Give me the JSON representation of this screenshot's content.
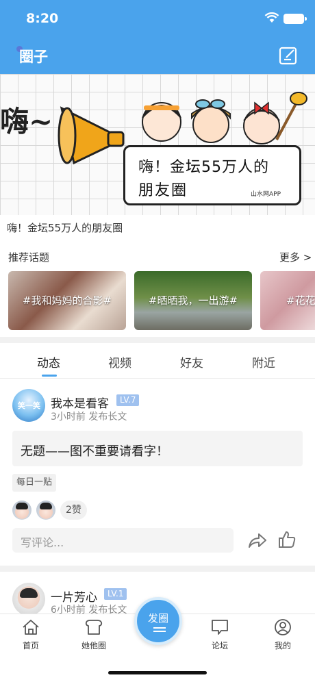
{
  "status_bar": {
    "time": "8:20"
  },
  "header": {
    "title": "圈子",
    "edit_icon": "edit-icon"
  },
  "banner": {
    "exclaim": "嗨~",
    "bubble_line1": "嗨！金坛55万人的",
    "bubble_line2": "朋友圈",
    "brand": "山水网APP",
    "caption": "嗨！金坛55万人的朋友圈"
  },
  "topics": {
    "title": "推荐话题",
    "more": "更多 >",
    "items": [
      "#我和妈妈的合影#",
      "#晒晒我，一出游#",
      "#花花"
    ]
  },
  "tabs": [
    "动态",
    "视频",
    "好友",
    "附近"
  ],
  "active_tab": "动态",
  "posts": [
    {
      "user": "我本是看客",
      "level": "LV.7",
      "meta": "3小时前  发布长文",
      "text": "无题——图不重要请看字！",
      "tag": "每日一贴",
      "likes": "2赞",
      "comment_placeholder": "写评论..."
    },
    {
      "user": "一片芳心",
      "level": "LV.1",
      "meta": "6小时前  发布长文"
    }
  ],
  "nav": {
    "items": [
      "首页",
      "她他圈",
      "论坛",
      "我的"
    ],
    "fab": "发圈"
  },
  "colors": {
    "accent": "#4aa3ec",
    "level_badge": "#9fc1ef"
  }
}
